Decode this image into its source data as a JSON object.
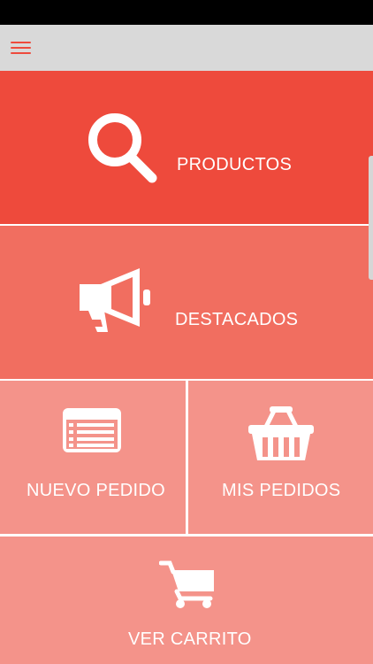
{
  "app": {
    "menu_icon": "hamburger-menu-icon",
    "accent_color": "#ee4a3c"
  },
  "tiles": {
    "productos": {
      "label": "PRODUCTOS",
      "icon": "search-icon",
      "color": "#ee4a3c"
    },
    "destacados": {
      "label": "DESTACADOS",
      "icon": "megaphone-icon",
      "color": "#f16e60"
    },
    "nuevo_pedido": {
      "label": "NUEVO PEDIDO",
      "icon": "list-form-icon",
      "color": "#f4938a"
    },
    "mis_pedidos": {
      "label": "MIS PEDIDOS",
      "icon": "basket-icon",
      "color": "#f4938a"
    },
    "ver_carrito": {
      "label": "VER CARRITO",
      "icon": "shopping-cart-icon",
      "color": "#f4938a"
    }
  }
}
